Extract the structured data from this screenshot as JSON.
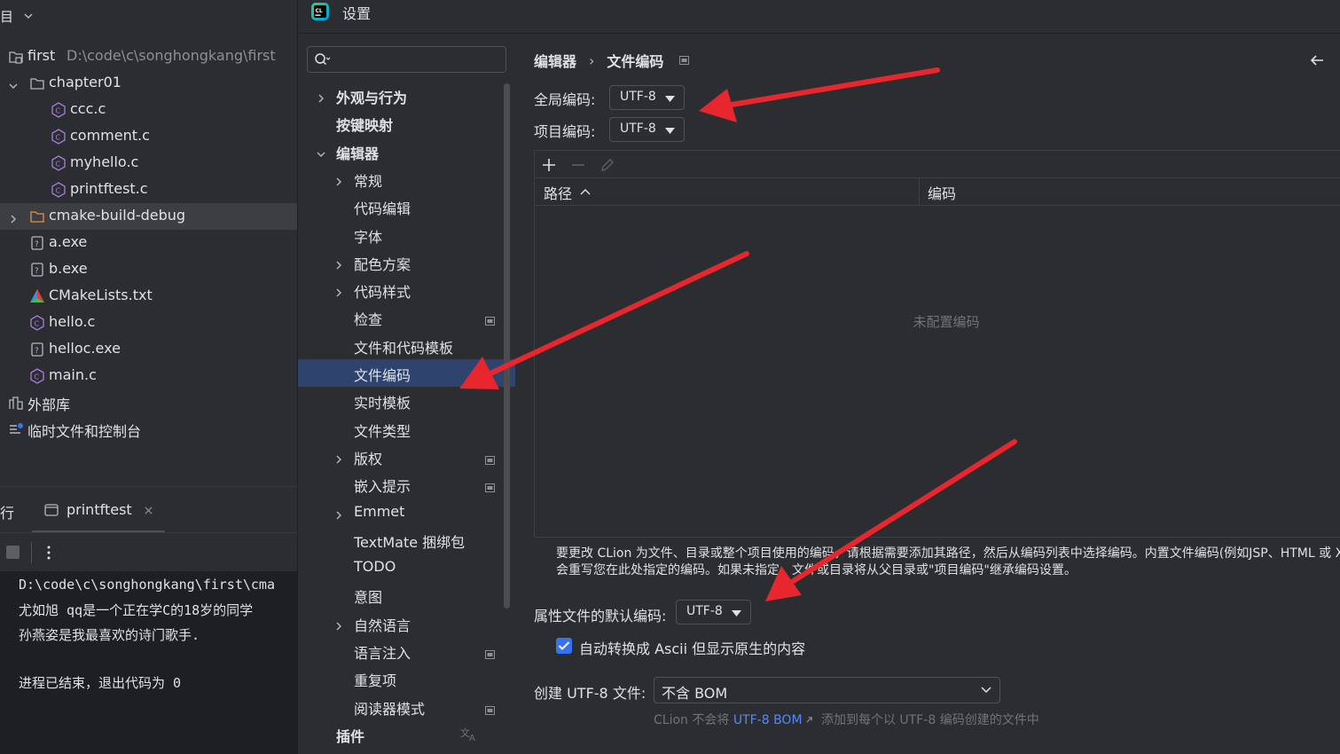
{
  "ide": {
    "project_header": "目",
    "tree": [
      {
        "label": "first",
        "path": "D:\\code\\c\\songhongkang\\first",
        "icon": "project-folder-icon",
        "depth": 0,
        "arrow": "none"
      },
      {
        "label": "chapter01",
        "icon": "folder-icon",
        "depth": 1,
        "arrow": "down"
      },
      {
        "label": "ccc.c",
        "icon": "c-file-icon",
        "depth": 2,
        "arrow": "none"
      },
      {
        "label": "comment.c",
        "icon": "c-file-icon",
        "depth": 2,
        "arrow": "none"
      },
      {
        "label": "myhello.c",
        "icon": "c-file-icon",
        "depth": 2,
        "arrow": "none"
      },
      {
        "label": "printftest.c",
        "icon": "c-file-icon",
        "depth": 2,
        "arrow": "none"
      },
      {
        "label": "cmake-build-debug",
        "icon": "folder-orange-icon",
        "depth": 1,
        "arrow": "right",
        "selected": true
      },
      {
        "label": "a.exe",
        "icon": "unknown-file-icon",
        "depth": 1,
        "arrow": "none"
      },
      {
        "label": "b.exe",
        "icon": "unknown-file-icon",
        "depth": 1,
        "arrow": "none"
      },
      {
        "label": "CMakeLists.txt",
        "icon": "cmake-icon",
        "depth": 1,
        "arrow": "none"
      },
      {
        "label": "hello.c",
        "icon": "c-file-icon",
        "depth": 1,
        "arrow": "none"
      },
      {
        "label": "helloc.exe",
        "icon": "unknown-file-icon",
        "depth": 1,
        "arrow": "none"
      },
      {
        "label": "main.c",
        "icon": "c-file-icon",
        "depth": 1,
        "arrow": "none"
      },
      {
        "label": "外部库",
        "icon": "library-icon",
        "depth": 0,
        "arrow": "none"
      },
      {
        "label": "临时文件和控制台",
        "icon": "scratches-icon",
        "depth": 0,
        "arrow": "none"
      }
    ],
    "run_panel_label": "行",
    "run_tab": "printftest",
    "console_lines": [
      "D:\\code\\c\\songhongkang\\first\\cma",
      "尤如旭 qq是一个正在学C的18岁的同学",
      "孙燕姿是我最喜欢的诗门歌手.",
      "",
      "进程已结束，退出代码为 0"
    ]
  },
  "dialog": {
    "title": "设置",
    "search_placeholder": "",
    "nav": [
      {
        "label": "外观与行为",
        "level": 0,
        "arrow": "right",
        "bold": true
      },
      {
        "label": "按键映射",
        "level": 0,
        "arrow": "none",
        "bold": true
      },
      {
        "label": "编辑器",
        "level": 0,
        "arrow": "down",
        "bold": true
      },
      {
        "label": "常规",
        "level": 1,
        "arrow": "right"
      },
      {
        "label": "代码编辑",
        "level": 1,
        "arrow": "none"
      },
      {
        "label": "字体",
        "level": 1,
        "arrow": "none"
      },
      {
        "label": "配色方案",
        "level": 1,
        "arrow": "right"
      },
      {
        "label": "代码样式",
        "level": 1,
        "arrow": "right"
      },
      {
        "label": "检查",
        "level": 1,
        "arrow": "none",
        "project": true
      },
      {
        "label": "文件和代码模板",
        "level": 1,
        "arrow": "none"
      },
      {
        "label": "文件编码",
        "level": 1,
        "arrow": "none",
        "selected": true
      },
      {
        "label": "实时模板",
        "level": 1,
        "arrow": "none"
      },
      {
        "label": "文件类型",
        "level": 1,
        "arrow": "none"
      },
      {
        "label": "版权",
        "level": 1,
        "arrow": "right",
        "project": true
      },
      {
        "label": "嵌入提示",
        "level": 1,
        "arrow": "none",
        "project": true
      },
      {
        "label": "Emmet",
        "level": 1,
        "arrow": "right"
      },
      {
        "label": "TextMate 捆绑包",
        "level": 1,
        "arrow": "none"
      },
      {
        "label": "TODO",
        "level": 1,
        "arrow": "none"
      },
      {
        "label": "意图",
        "level": 1,
        "arrow": "none"
      },
      {
        "label": "自然语言",
        "level": 1,
        "arrow": "right"
      },
      {
        "label": "语言注入",
        "level": 1,
        "arrow": "none",
        "project": true
      },
      {
        "label": "重复项",
        "level": 1,
        "arrow": "none"
      },
      {
        "label": "阅读器模式",
        "level": 1,
        "arrow": "none",
        "project": true
      },
      {
        "label": "插件",
        "level": 0,
        "arrow": "none",
        "bold": true
      }
    ],
    "breadcrumb": [
      "编辑器",
      "文件编码"
    ],
    "global_encoding_label": "全局编码:",
    "global_encoding_value": "UTF-8",
    "project_encoding_label": "项目编码:",
    "project_encoding_value": "UTF-8",
    "table_headers": [
      "路径",
      "编码"
    ],
    "table_empty": "未配置编码",
    "hint_lines": [
      "要更改 CLion 为文件、目录或整个项目使用的编码，请根据需要添加其路径，然后从编码列表中选择编码。内置文件编码(例如JSP、HTML 或 X",
      "会重写您在此处指定的编码。如果未指定，文件或目录将从父目录或\"项目编码\"继承编码设置。"
    ],
    "properties_label": "属性文件的默认编码:",
    "properties_value": "UTF-8",
    "ascii_checkbox_label": "自动转换成 Ascii 但显示原生的内容",
    "ascii_checked": true,
    "bom_label": "创建 UTF-8 文件:",
    "bom_value": "不含 BOM",
    "bom_note_prefix": "CLion 不会将",
    "bom_note_link": "UTF-8 BOM",
    "bom_note_suffix": "添加到每个以 UTF-8 编码创建的文件中"
  },
  "colors": {
    "annotation_arrow": "#e8262d",
    "selection": "#2e436e",
    "accent": "#3574f0",
    "link": "#548af7"
  }
}
